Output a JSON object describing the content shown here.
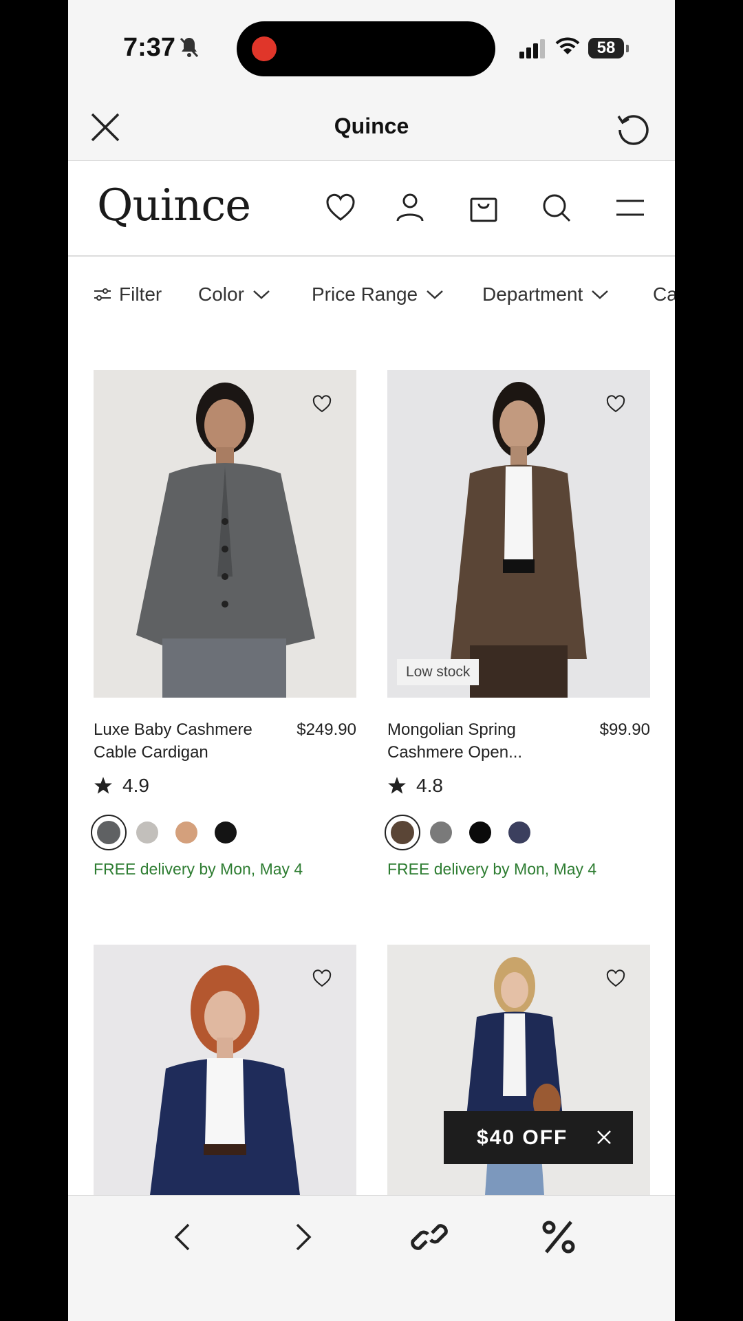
{
  "status_bar": {
    "time": "7:37",
    "battery": "58"
  },
  "app_bar": {
    "title": "Quince"
  },
  "site_header": {
    "logo": "Quince"
  },
  "filters": [
    "Filter",
    "Color",
    "Price Range",
    "Department",
    "Ca"
  ],
  "products": [
    {
      "name_line1": "Luxe Baby Cashmere",
      "name_line2": "Cable Cardigan",
      "price": "$249.90",
      "rating": "4.9",
      "swatches": [
        "#5f6163",
        "#c2bfbb",
        "#d4a07c",
        "#141414"
      ],
      "delivery": "FREE delivery by Mon, May 4",
      "badge": ""
    },
    {
      "name_line1": "Mongolian Spring",
      "name_line2": "Cashmere Open...",
      "price": "$99.90",
      "rating": "4.8",
      "swatches": [
        "#5a4536",
        "#7a7a7a",
        "#0a0a0a",
        "#3b3f5e"
      ],
      "delivery": "FREE delivery by Mon, May 4",
      "badge": "Low stock"
    }
  ],
  "promo": {
    "label": "$40 OFF"
  },
  "colors": {
    "delivery_green": "#2e7d32",
    "promo_bg": "#1d1d1d",
    "recording_red": "#e0362a"
  }
}
